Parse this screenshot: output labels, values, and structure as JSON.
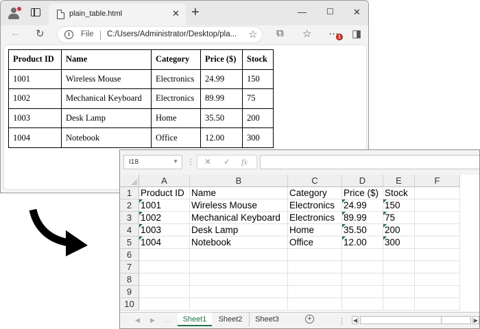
{
  "browser": {
    "tab_title": "plain_table.html",
    "address": {
      "scheme_label": "File",
      "url": "C:/Users/Administrator/Desktop/pla..."
    },
    "notification_badge": "1",
    "table": {
      "headers": [
        "Product ID",
        "Name",
        "Category",
        "Price ($)",
        "Stock"
      ],
      "rows": [
        [
          "1001",
          "Wireless Mouse",
          "Electronics",
          "24.99",
          "150"
        ],
        [
          "1002",
          "Mechanical Keyboard",
          "Electronics",
          "89.99",
          "75"
        ],
        [
          "1003",
          "Desk Lamp",
          "Home",
          "35.50",
          "200"
        ],
        [
          "1004",
          "Notebook",
          "Office",
          "12.00",
          "300"
        ]
      ]
    }
  },
  "excel": {
    "name_box": "I18",
    "columns": [
      "A",
      "B",
      "C",
      "D",
      "E",
      "F"
    ],
    "row_numbers": [
      "1",
      "2",
      "3",
      "4",
      "5",
      "6",
      "7",
      "8",
      "9",
      "10"
    ],
    "cells": [
      [
        "Product ID",
        "Name",
        "Category",
        "Price ($)",
        "Stock"
      ],
      [
        "1001",
        "Wireless Mouse",
        "Electronics",
        "24.99",
        "150"
      ],
      [
        "1002",
        "Mechanical Keyboard",
        "Electronics",
        "89.99",
        "75"
      ],
      [
        "1003",
        "Desk Lamp",
        "Home",
        "35.50",
        "200"
      ],
      [
        "1004",
        "Notebook",
        "Office",
        "12.00",
        "300"
      ]
    ],
    "sheets": [
      "Sheet1",
      "Sheet2",
      "Sheet3"
    ],
    "active_sheet": "Sheet1",
    "colors": {
      "accent": "#217346",
      "error_indicator": "#1e7145"
    }
  }
}
